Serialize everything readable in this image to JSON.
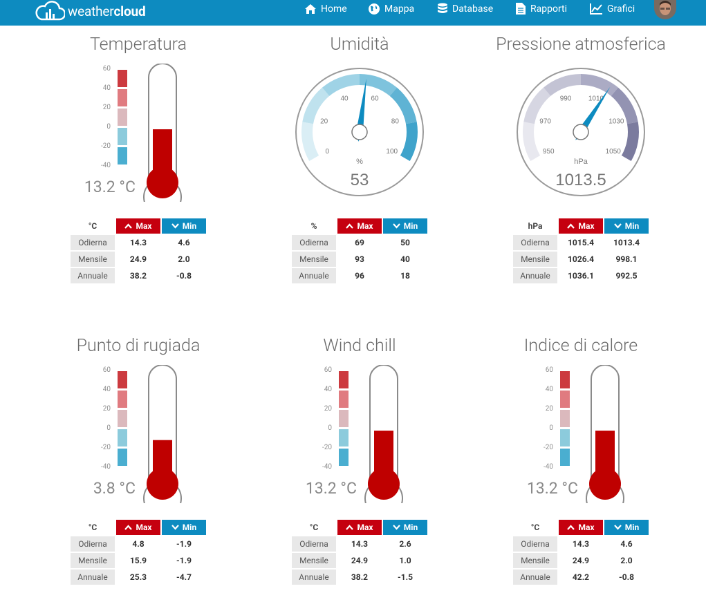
{
  "header": {
    "logo_light": "weather",
    "logo_bold": "cloud",
    "nav": [
      {
        "label": "Home",
        "icon": "home-icon"
      },
      {
        "label": "Mappa",
        "icon": "globe-icon"
      },
      {
        "label": "Database",
        "icon": "database-icon"
      },
      {
        "label": "Rapporti",
        "icon": "document-icon"
      },
      {
        "label": "Grafici",
        "icon": "line-chart-icon"
      }
    ]
  },
  "colors": {
    "accent": "#0d8bc0",
    "max_red": "#c5000f",
    "thermo_fill": "#bf0000",
    "needle": "#0d8bc0"
  },
  "thermo_scale": [
    "60",
    "40",
    "20",
    "0",
    "-20",
    "-40"
  ],
  "row_labels": [
    "Odierna",
    "Mensile",
    "Annuale"
  ],
  "max_label": "Max",
  "min_label": "Min",
  "cards": [
    {
      "title": "Temperatura",
      "value": "13.2 °C",
      "level": 0.553,
      "unit": "°C",
      "rows": [
        {
          "max": "14.3",
          "min": "4.6"
        },
        {
          "max": "24.9",
          "min": "2.0"
        },
        {
          "max": "38.2",
          "min": "-0.8"
        }
      ]
    },
    {
      "title": "Umidità",
      "value": "53",
      "unit": "%",
      "gauge_unit": "%",
      "gauge_ticks": [
        "0",
        "20",
        "40",
        "60",
        "80",
        "100"
      ],
      "gauge_fraction": 0.53,
      "rows": [
        {
          "max": "69",
          "min": "50"
        },
        {
          "max": "93",
          "min": "40"
        },
        {
          "max": "96",
          "min": "18"
        }
      ]
    },
    {
      "title": "Pressione atmosferica",
      "value": "1013.5",
      "unit": "hPa",
      "gauge_unit": "hPa",
      "gauge_ticks": [
        "950",
        "970",
        "990",
        "1010",
        "1030",
        "1050"
      ],
      "gauge_fraction": 0.6375,
      "rows": [
        {
          "max": "1015.4",
          "min": "1013.4"
        },
        {
          "max": "1026.4",
          "min": "998.1"
        },
        {
          "max": "1036.1",
          "min": "992.5"
        }
      ]
    },
    {
      "title": "Punto di rugiada",
      "value": "3.8 °C",
      "level": 0.462,
      "unit": "°C",
      "rows": [
        {
          "max": "4.8",
          "min": "-1.9"
        },
        {
          "max": "15.9",
          "min": "-1.9"
        },
        {
          "max": "25.3",
          "min": "-4.7"
        }
      ]
    },
    {
      "title": "Wind chill",
      "value": "13.2 °C",
      "level": 0.553,
      "unit": "°C",
      "rows": [
        {
          "max": "14.3",
          "min": "2.6"
        },
        {
          "max": "24.9",
          "min": "1.0"
        },
        {
          "max": "38.2",
          "min": "-1.5"
        }
      ]
    },
    {
      "title": "Indice di calore",
      "value": "13.2 °C",
      "level": 0.553,
      "unit": "°C",
      "rows": [
        {
          "max": "14.3",
          "min": "4.6"
        },
        {
          "max": "24.9",
          "min": "2.0"
        },
        {
          "max": "42.2",
          "min": "-0.8"
        }
      ]
    }
  ]
}
